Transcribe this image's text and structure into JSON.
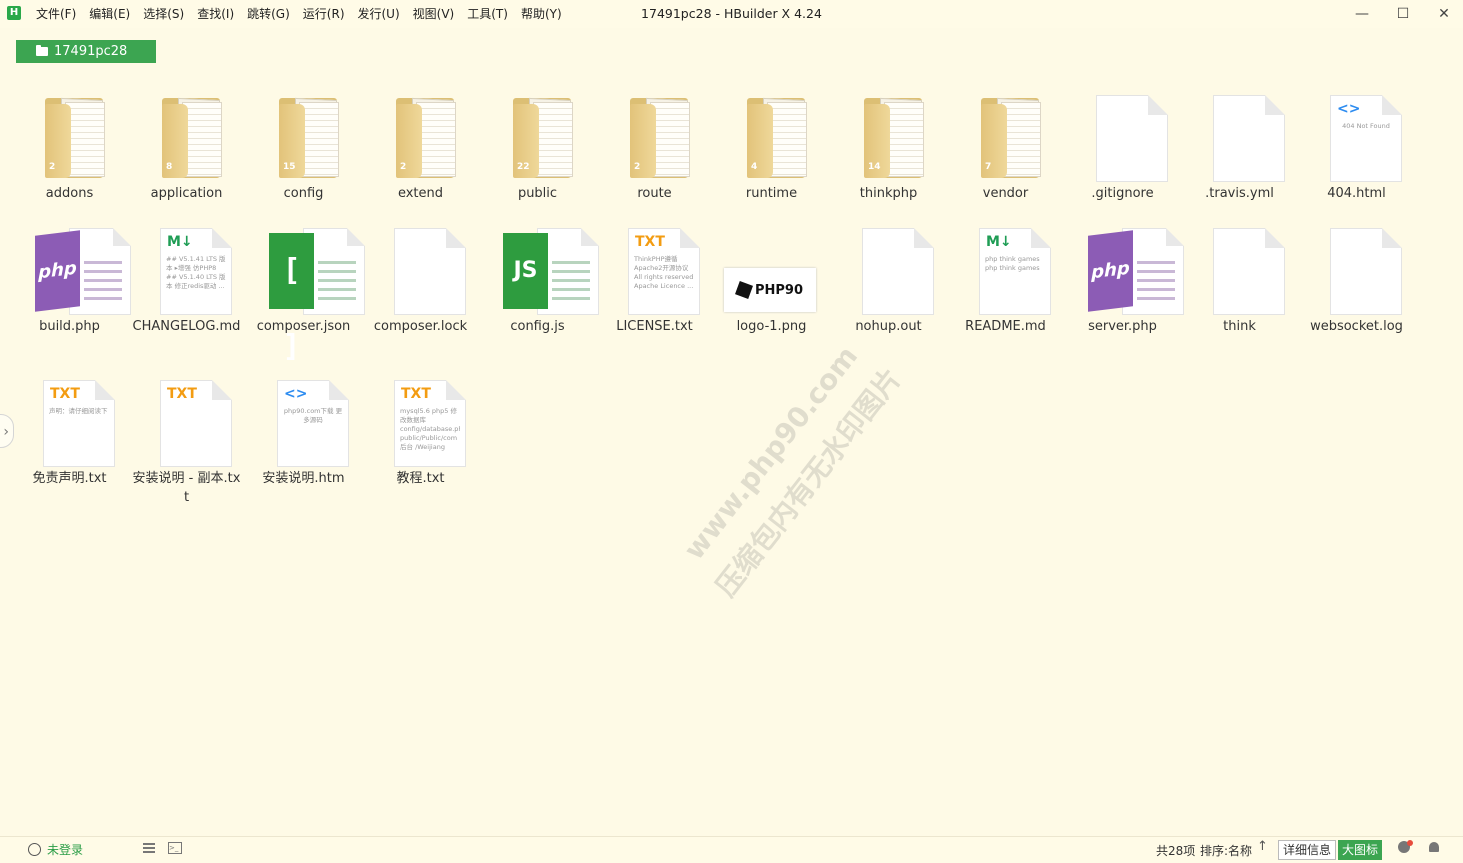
{
  "app": {
    "logo_letter": "H",
    "window_title": "17491pc28 - HBuilder X 4.24",
    "window_controls": {
      "minimize": "—",
      "maximize": "☐",
      "close": "✕"
    }
  },
  "menu": [
    "文件(F)",
    "编辑(E)",
    "选择(S)",
    "查找(I)",
    "跳转(G)",
    "运行(R)",
    "发行(U)",
    "视图(V)",
    "工具(T)",
    "帮助(Y)"
  ],
  "breadcrumb": {
    "label": "17491pc28"
  },
  "files": [
    {
      "name": "addons",
      "kind": "folder",
      "count": "2"
    },
    {
      "name": "application",
      "kind": "folder",
      "count": "8"
    },
    {
      "name": "config",
      "kind": "folder",
      "count": "15"
    },
    {
      "name": "extend",
      "kind": "folder",
      "count": "2"
    },
    {
      "name": "public",
      "kind": "folder",
      "count": "22"
    },
    {
      "name": "route",
      "kind": "folder",
      "count": "2"
    },
    {
      "name": "runtime",
      "kind": "folder",
      "count": "4"
    },
    {
      "name": "thinkphp",
      "kind": "folder",
      "count": "14"
    },
    {
      "name": "vendor",
      "kind": "folder",
      "count": "7"
    },
    {
      "name": ".gitignore",
      "kind": "blank"
    },
    {
      "name": ".travis.yml",
      "kind": "blank"
    },
    {
      "name": "404.html",
      "kind": "code",
      "tag": "<>",
      "preview": "404 Not Found"
    },
    {
      "name": "build.php",
      "kind": "php",
      "tag": "php"
    },
    {
      "name": "CHANGELOG.md",
      "kind": "md",
      "tag": "M↓",
      "preview": "## V5.1.41 LTS 版本 ▸增强 仿PHP8 ## V5.1.40 LTS 版本 修正redis驱动 ..."
    },
    {
      "name": "composer.json",
      "kind": "json",
      "tag": "[ ]"
    },
    {
      "name": "composer.lock",
      "kind": "blank"
    },
    {
      "name": "config.js",
      "kind": "js",
      "tag": "JS"
    },
    {
      "name": "LICENSE.txt",
      "kind": "txt",
      "tag": "TXT",
      "preview": "ThinkPHP遵循Apache2开源协议 All rights reserved Apache Licence ..."
    },
    {
      "name": "logo-1.png",
      "kind": "image",
      "brand": "PHP90"
    },
    {
      "name": "nohup.out",
      "kind": "blank"
    },
    {
      "name": "README.md",
      "kind": "md",
      "tag": "M↓",
      "preview": "php think games php think games"
    },
    {
      "name": "server.php",
      "kind": "php",
      "tag": "php"
    },
    {
      "name": "think",
      "kind": "blank"
    },
    {
      "name": "websocket.log",
      "kind": "blank"
    },
    {
      "name": "免责声明.txt",
      "kind": "txt",
      "tag": "TXT",
      "preview": "声明：请仔细阅读下"
    },
    {
      "name": "安装说明 - 副本.txt",
      "kind": "txt",
      "tag": "TXT",
      "preview": ""
    },
    {
      "name": "安装说明.htm",
      "kind": "code",
      "tag": "<>",
      "preview": "php90.com下载 更多源码"
    },
    {
      "name": "教程.txt",
      "kind": "txt",
      "tag": "TXT",
      "preview": "mysql5.6 php5 修改数据库 config/database.php public/Public/com 后台 /Weijiang"
    }
  ],
  "side_toggle": "›",
  "watermark": {
    "line1": "www.php90.com",
    "line2": "压缩包内有无水印图片"
  },
  "status": {
    "login": "未登录",
    "terminal_glyph": ">_",
    "count": "共28项",
    "sort": "排序:名称",
    "sort_arrow": "↑",
    "view_details": "详细信息",
    "view_large": "大图标"
  }
}
